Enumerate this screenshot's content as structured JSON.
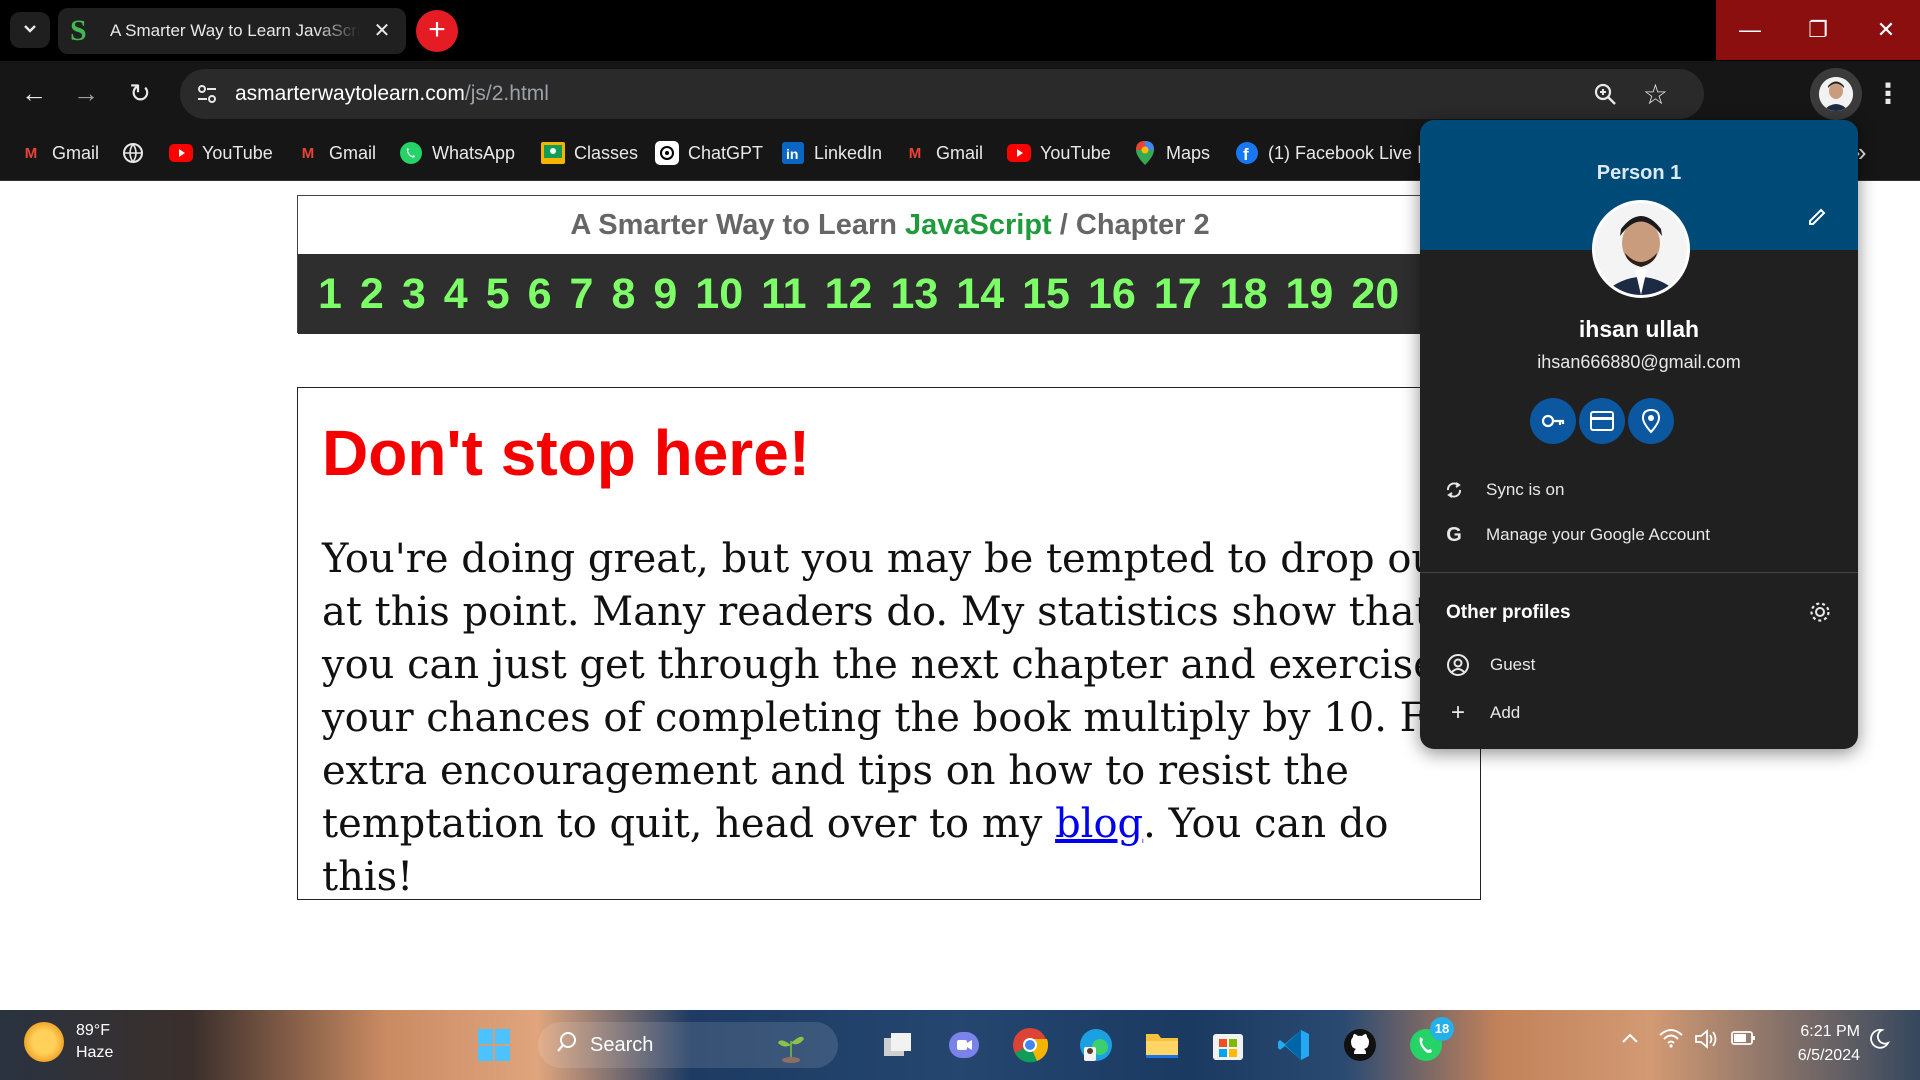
{
  "browser": {
    "tab": {
      "title": "A Smarter Way to Learn JavaScript",
      "favicon_letter": "S",
      "close": "✕"
    },
    "new_tab": "+",
    "window_controls": {
      "minimize": "—",
      "maximize": "❐",
      "close": "✕"
    },
    "toolbar": {
      "back": "←",
      "forward": "→",
      "reload": "↻",
      "url_host": "asmarterwaytolearn.com",
      "url_path": "/js/2.html",
      "menu": "⋮"
    },
    "bookmarks": [
      {
        "label": "Gmail",
        "icon": "gmail-icon",
        "glyph": "M",
        "color": "#ea4335"
      },
      {
        "label": "",
        "icon": "globe-icon",
        "glyph": "🌐",
        "color": "#e8e8e8"
      },
      {
        "label": "YouTube",
        "icon": "youtube-icon",
        "glyph": "▶",
        "color": "#ff0000"
      },
      {
        "label": "Gmail",
        "icon": "gmail-icon",
        "glyph": "M",
        "color": "#ea4335"
      },
      {
        "label": "WhatsApp",
        "icon": "whatsapp-icon",
        "glyph": "✆",
        "color": "#25d366"
      },
      {
        "label": "Classes",
        "icon": "classroom-icon",
        "glyph": "▣",
        "color": "#f4b400"
      },
      {
        "label": "ChatGPT",
        "icon": "chatgpt-icon",
        "glyph": "✺",
        "color": "#ffffff"
      },
      {
        "label": "LinkedIn",
        "icon": "linkedin-icon",
        "glyph": "in",
        "color": "#0a66c2"
      },
      {
        "label": "Gmail",
        "icon": "gmail-icon",
        "glyph": "M",
        "color": "#ea4335"
      },
      {
        "label": "YouTube",
        "icon": "youtube-icon",
        "glyph": "▶",
        "color": "#ff0000"
      },
      {
        "label": "Maps",
        "icon": "maps-icon",
        "glyph": "📍",
        "color": "#34a853"
      },
      {
        "label": "(1) Facebook Live |",
        "icon": "facebook-icon",
        "glyph": "f",
        "color": "#1877f2"
      }
    ],
    "bookmarks_more": "»"
  },
  "page": {
    "chapter_title_prefix": "A Smarter Way to Learn ",
    "chapter_title_js": "JavaScript",
    "chapter_title_suffix": " / Chapter 2",
    "chapters": [
      "1",
      "2",
      "3",
      "4",
      "5",
      "6",
      "7",
      "8",
      "9",
      "10",
      "11",
      "12",
      "13",
      "14",
      "15",
      "16",
      "17",
      "18",
      "19",
      "20"
    ],
    "headline": "Don't stop here!",
    "body_before_link": "You're doing great, but you may be tempted to drop out at this point. Many readers do. My statistics show that if you can just get through the next chapter and exercises, your chances of completing the book multiply by 10. For extra encouragement and tips on how to resist the temptation to quit, head over to my ",
    "body_link": "blog",
    "body_after_link": ". You can do this!"
  },
  "profile_popup": {
    "header": "Person 1",
    "name": "ihsan ullah",
    "email": "ihsan666880@gmail.com",
    "quick_actions": [
      "passwords-key-icon",
      "payment-card-icon",
      "address-pin-icon"
    ],
    "sync": "Sync is on",
    "manage": "Manage your Google Account",
    "other_profiles_title": "Other profiles",
    "guest": "Guest",
    "add": "Add"
  },
  "taskbar": {
    "weather_temp": "89°F",
    "weather_cond": "Haze",
    "search_label": "Search",
    "whatsapp_badge": "18",
    "time": "6:21 PM",
    "date": "6/5/2024"
  },
  "colors": {
    "accent_red": "#f40000",
    "js_green": "#1f9b3c",
    "chapter_green": "#7dff68",
    "popup_header": "#004a77"
  }
}
